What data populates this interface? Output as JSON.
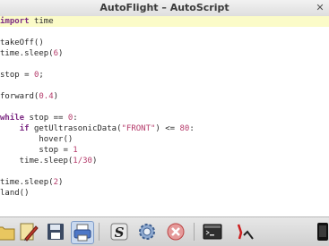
{
  "window": {
    "title": "AutoFlight – AutoScript"
  },
  "code_lines": [
    "import time",
    "",
    "takeOff()",
    "time.sleep(6)",
    "",
    "stop = 0;",
    "",
    "forward(0.4)",
    "",
    "while stop == 0:",
    "    if getUltrasonicData(\"FRONT\") <= 80:",
    "        hover()",
    "        stop = 1",
    "    time.sleep(1/30)",
    "",
    "time.sleep(2)",
    "land()"
  ],
  "toolbar": {
    "buttons": [
      {
        "name": "open-script",
        "icon": "folder-icon"
      },
      {
        "name": "edit-script",
        "icon": "pencil-icon"
      },
      {
        "name": "save-script",
        "icon": "floppy-icon"
      },
      {
        "name": "print-script",
        "icon": "printer-icon"
      },
      {
        "name": "syntax-check",
        "icon": "script-s-icon"
      },
      {
        "name": "settings",
        "icon": "gear-icon"
      },
      {
        "name": "stop-script",
        "icon": "cancel-icon"
      },
      {
        "name": "console",
        "icon": "terminal-icon"
      },
      {
        "name": "drone",
        "icon": "drone-icon"
      },
      {
        "name": "phone",
        "icon": "phone-icon"
      }
    ]
  },
  "colors": {
    "highlight_line": "#fbfbc8",
    "keyword": "#7d2b84",
    "literal": "#b53a6a"
  }
}
